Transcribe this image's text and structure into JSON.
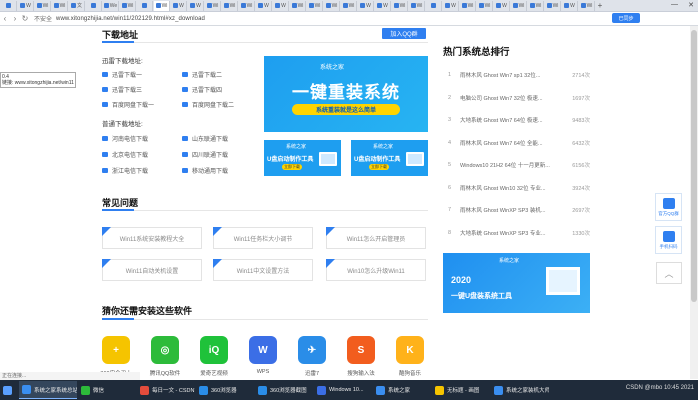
{
  "browser": {
    "tabs": [
      "",
      "W",
      "Wi",
      "Wi",
      "文",
      "",
      "We",
      "Wi",
      "",
      "Wi",
      "W",
      "W",
      "Wi",
      "Wi",
      "Wi",
      "W",
      "W",
      "Wi",
      "Wi",
      "Wi",
      "Wi",
      "W",
      "W",
      "Wi",
      "Wi",
      "",
      "W",
      "Wi",
      "Wi",
      "W",
      "Wi",
      "Wi",
      "Wi",
      "W",
      "Wi"
    ],
    "active_tab_index": 9,
    "insecure_label": "不安全",
    "url": "www.xitongzhijia.net/win11/202129.html#xz_download",
    "profile_label": "已同步"
  },
  "tooltip": {
    "line1": "0.4",
    "line2": "链接: www.xitongzhijia.net/win11"
  },
  "download": {
    "title": "下载地址",
    "qq_button": "加入QQ群",
    "thunder_label": "迅雷下载地址:",
    "thunder_links": [
      "迅雷下载一",
      "迅雷下载二",
      "迅雷下载三",
      "迅雷下载四",
      "百度网盘下载一",
      "百度网盘下载二"
    ],
    "normal_label": "普通下载地址:",
    "normal_links": [
      "河南电信下载",
      "山东联通下载",
      "北京电信下载",
      "四川联通下载",
      "浙江电信下载",
      "移动通用下载"
    ],
    "banner_big": {
      "logo": "系统之家",
      "title": "一键重装系统",
      "sub": "系统重装就是这么简单"
    },
    "banner_small": [
      {
        "logo": "系统之家",
        "title": "U盘启动制作工具",
        "button": "立即下载"
      },
      {
        "logo": "系统之家",
        "title": "U盘启动制作工具",
        "button": "立即下载"
      }
    ]
  },
  "faq": {
    "title": "常见问题",
    "items": [
      "Win11系统安装教程大全",
      "Win11任务栏大小调节",
      "Win11怎么开启管理员",
      "Win11自动关机设置",
      "Win11中文设置方法",
      "Win10怎么升级Win11"
    ]
  },
  "apps": {
    "title": "猜你还需安装这些软件",
    "items": [
      {
        "label": "360安全卫士",
        "glyph": "+",
        "color": "#f5c400"
      },
      {
        "label": "腾讯QQ软件",
        "glyph": "◎",
        "color": "#2dbb3a"
      },
      {
        "label": "爱奇艺视频",
        "glyph": "iQ",
        "color": "#1fc23a"
      },
      {
        "label": "WPS",
        "glyph": "W",
        "color": "#3b6ee6"
      },
      {
        "label": "迅雷7",
        "glyph": "✈",
        "color": "#2a8de8"
      },
      {
        "label": "搜狗输入法",
        "glyph": "S",
        "color": "#f25d1e"
      },
      {
        "label": "酷狗音乐",
        "glyph": "K",
        "color": "#ffb21a"
      }
    ]
  },
  "ranking": {
    "title": "热门系统总排行",
    "items": [
      {
        "rank": "1",
        "title": "雨林木风 Ghost Win7 sp1 32位...",
        "count": "2714次"
      },
      {
        "rank": "2",
        "title": "电脑公司 Ghost Win7 32位 极速...",
        "count": "1697次"
      },
      {
        "rank": "3",
        "title": "大地系统 Ghost Win7 64位 极速...",
        "count": "9483次"
      },
      {
        "rank": "4",
        "title": "雨林木风 Ghost Win7 64位 全能...",
        "count": "6432次"
      },
      {
        "rank": "5",
        "title": "Windows10 21H2 64位 十一月更新...",
        "count": "6156次"
      },
      {
        "rank": "6",
        "title": "雨林木风 Ghost Win10 32位 专业...",
        "count": "3924次"
      },
      {
        "rank": "7",
        "title": "雨林木风 Ghost WinXP SP3 装机...",
        "count": "2697次"
      },
      {
        "rank": "8",
        "title": "大地系统 Ghost WinXP SP3 专业...",
        "count": "1330次"
      }
    ],
    "banner": {
      "logo": "系统之家",
      "year": "2020",
      "title": "一键U盘装系统工具"
    }
  },
  "float": {
    "qq_label": "官方QQ群",
    "mobile_label": "手机扫码"
  },
  "status_text": "正在连接...",
  "taskbar": {
    "items": [
      {
        "label": "系统之家系统总站",
        "color": "#3a8ef0"
      },
      {
        "label": "微信",
        "color": "#2dbb3a"
      },
      {
        "label": "每日一文 - CSDN博客",
        "color": "#e34c3c"
      },
      {
        "label": "360浏览器",
        "color": "#2a8de8"
      },
      {
        "label": "360浏览器截图",
        "color": "#2a8de8"
      },
      {
        "label": "Windows 10...",
        "color": "#3b6ee6"
      },
      {
        "label": "系统之家",
        "color": "#3a8ef0"
      },
      {
        "label": "无标题 - 画图",
        "color": "#f5c400"
      },
      {
        "label": "系统之家装机大师",
        "color": "#3a8ef0"
      }
    ],
    "tray_text": "CSDN @mbo 10:45 2021"
  }
}
